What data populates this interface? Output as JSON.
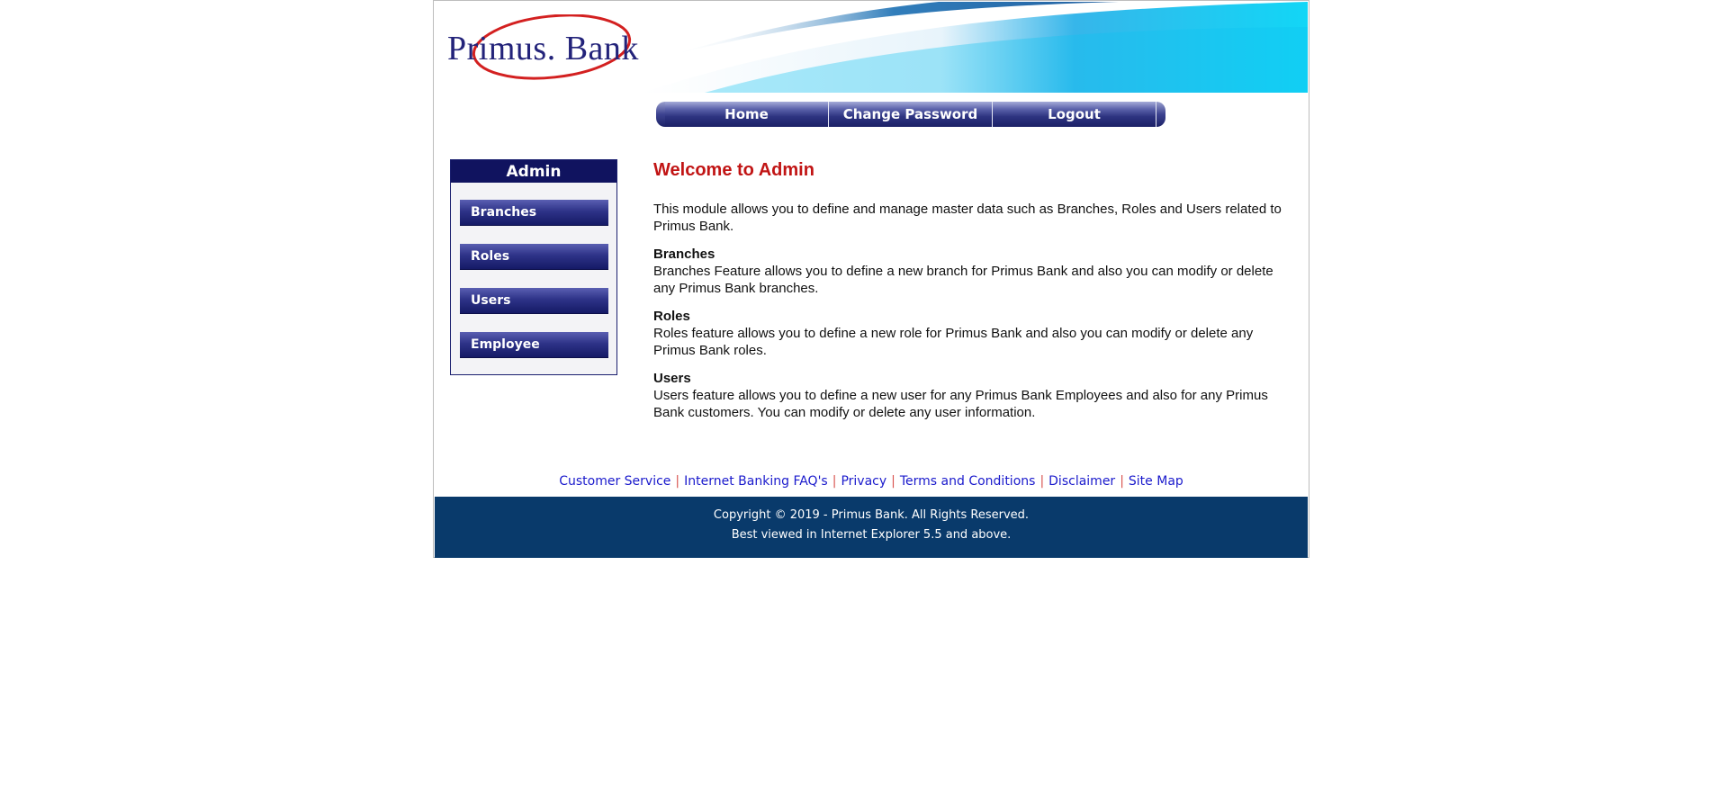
{
  "brand": {
    "name_part1": "Primus.",
    "name_part2": "Bank",
    "logo_ring_color": "#d32020",
    "text_color": "#23237a",
    "banner_gradient": [
      "#ffffff",
      "#0aa9e6",
      "#1fd6f5"
    ]
  },
  "nav": {
    "items": [
      {
        "label": "Home"
      },
      {
        "label": "Change Password"
      },
      {
        "label": "Logout"
      }
    ]
  },
  "sidebar": {
    "title": "Admin",
    "items": [
      {
        "label": "Branches"
      },
      {
        "label": "Roles"
      },
      {
        "label": "Users"
      },
      {
        "label": "Employee"
      }
    ]
  },
  "main": {
    "title": "Welcome to Admin",
    "intro": "This module allows you to define and manage master data such as Branches, Roles and Users related to Primus Bank.",
    "sections": [
      {
        "heading": "Branches",
        "text": "Branches Feature allows you to define a new branch for Primus Bank and also you can modify or delete any Primus Bank branches."
      },
      {
        "heading": "Roles",
        "text": "Roles feature allows you to define a new role for Primus Bank and also you can modify or delete any Primus Bank roles."
      },
      {
        "heading": "Users",
        "text": "Users feature allows you to define a new user for any Primus Bank Employees and also for any Primus Bank customers. You can modify or delete any user information."
      }
    ]
  },
  "footer": {
    "links": [
      {
        "label": "Customer Service"
      },
      {
        "label": "Internet Banking FAQ's"
      },
      {
        "label": "Privacy"
      },
      {
        "label": "Terms and Conditions"
      },
      {
        "label": "Disclaimer"
      },
      {
        "label": "Site Map"
      }
    ],
    "separator": "|",
    "copyright": "Copyright © 2019 - Primus Bank. All Rights Reserved.",
    "browser_note": "Best viewed in Internet Explorer 5.5 and above.",
    "bar_color": "#093a6b"
  },
  "colors": {
    "title_red": "#c11414",
    "nav_dark": "#1d2368",
    "link_blue": "#1a1acc"
  }
}
